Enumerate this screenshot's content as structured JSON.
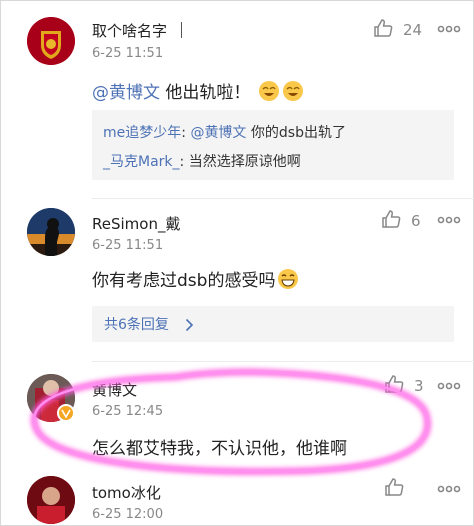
{
  "comments": [
    {
      "user": "取个啥名字",
      "time": "6-25 11:51",
      "likes": "24",
      "mention": "@黄博文",
      "text": " 他出轨啦！",
      "replies": [
        {
          "user": "me追梦少年",
          "sep": ": ",
          "mention": "@黄博文",
          "text": " 你的dsb出轨了"
        },
        {
          "user": "_马克Mark_",
          "sep": ": ",
          "text": "当然选择原谅他啊"
        }
      ]
    },
    {
      "user": "ReSimon_戴",
      "time": "6-25 11:51",
      "likes": "6",
      "text": "你有考虑过dsb的感受吗",
      "more_replies": "共6条回复"
    },
    {
      "user": "黄博文",
      "time": "6-25 12:45",
      "likes": "3",
      "text": "怎么都艾特我，不认识他，他谁啊"
    },
    {
      "user": "tomo冰化",
      "time": "6-25 12:00"
    }
  ],
  "colors": {
    "link": "#4d72b6",
    "highlight_circle": "#ff5ce1",
    "quote_bg": "#f4f4f4",
    "meta_gray": "#888888"
  }
}
